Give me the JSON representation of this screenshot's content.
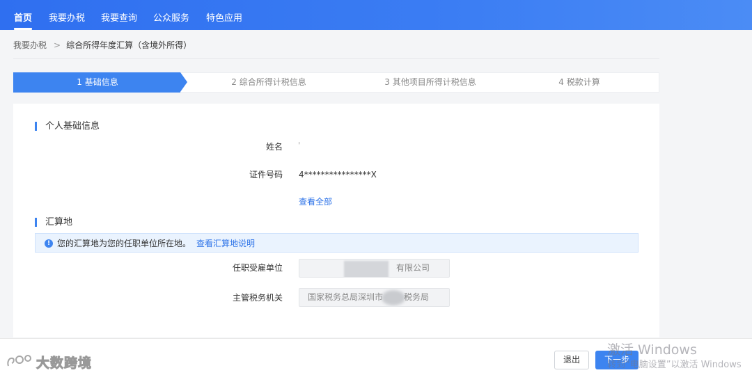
{
  "nav": {
    "items": [
      {
        "label": "首页",
        "active": true
      },
      {
        "label": "我要办税"
      },
      {
        "label": "我要查询"
      },
      {
        "label": "公众服务"
      },
      {
        "label": "特色应用"
      }
    ]
  },
  "breadcrumb": {
    "parent": "我要办税",
    "separator": ">",
    "current": "综合所得年度汇算（含境外所得）"
  },
  "steps": [
    {
      "label": "1  基础信息",
      "active": true
    },
    {
      "label": "2  综合所得计税信息"
    },
    {
      "label": "3  其他项目所得计税信息"
    },
    {
      "label": "4  税款计算"
    }
  ],
  "personal": {
    "title": "个人基础信息",
    "name_label": "姓名",
    "name_value": "'",
    "id_label": "证件号码",
    "id_value": "4****************X",
    "view_all": "查看全部"
  },
  "settlement": {
    "title": "汇算地",
    "notice_text": "您的汇算地为您的任职单位所在地。",
    "notice_link": "查看汇算地说明",
    "employer_label": "任职受雇单位",
    "employer_value": "有限公司",
    "tax_office_label": "主管税务机关",
    "tax_office_value_prefix": "国家税务总局深圳市",
    "tax_office_value_suffix": "税务局"
  },
  "footer": {
    "exit_label": "退出",
    "next_label": "下一步"
  },
  "watermark": {
    "text": "大数跨境"
  },
  "os_overlay": {
    "line1": "激活 Windows",
    "line2": "转到“电脑设置”以激活 Windows"
  },
  "colors": {
    "nav_bg": "#3b7df3",
    "accent": "#3d84f0",
    "link": "#2f74e8",
    "notice_bg": "#eaf3fe"
  },
  "icons": [
    "info-icon",
    "chevron-right-icon",
    "watermark-logo-icon"
  ]
}
